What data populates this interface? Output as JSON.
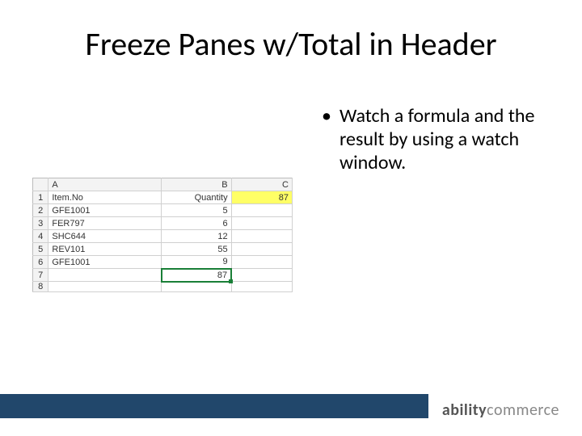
{
  "title": "Freeze Panes w/Total in Header",
  "bullet": {
    "dot": "•",
    "text": "Watch a formula and the result by using a watch window."
  },
  "sheet": {
    "cols": [
      "A",
      "B",
      "C"
    ],
    "rows": [
      {
        "n": "1",
        "a": "Item.No",
        "b": "Quantity",
        "c": "87",
        "c_hl": true,
        "b_align": "right"
      },
      {
        "n": "2",
        "a": "GFE1001",
        "b": "5",
        "c": ""
      },
      {
        "n": "3",
        "a": "FER797",
        "b": "6",
        "c": ""
      },
      {
        "n": "4",
        "a": "SHC644",
        "b": "12",
        "c": ""
      },
      {
        "n": "5",
        "a": "REV101",
        "b": "55",
        "c": ""
      },
      {
        "n": "6",
        "a": "GFE1001",
        "b": "9",
        "c": ""
      },
      {
        "n": "7",
        "a": "",
        "b": "87",
        "c": "",
        "b_sel": true
      },
      {
        "n": "8",
        "a": "",
        "b": "",
        "c": ""
      }
    ]
  },
  "logo": {
    "bold": "ability",
    "light": "commerce"
  }
}
